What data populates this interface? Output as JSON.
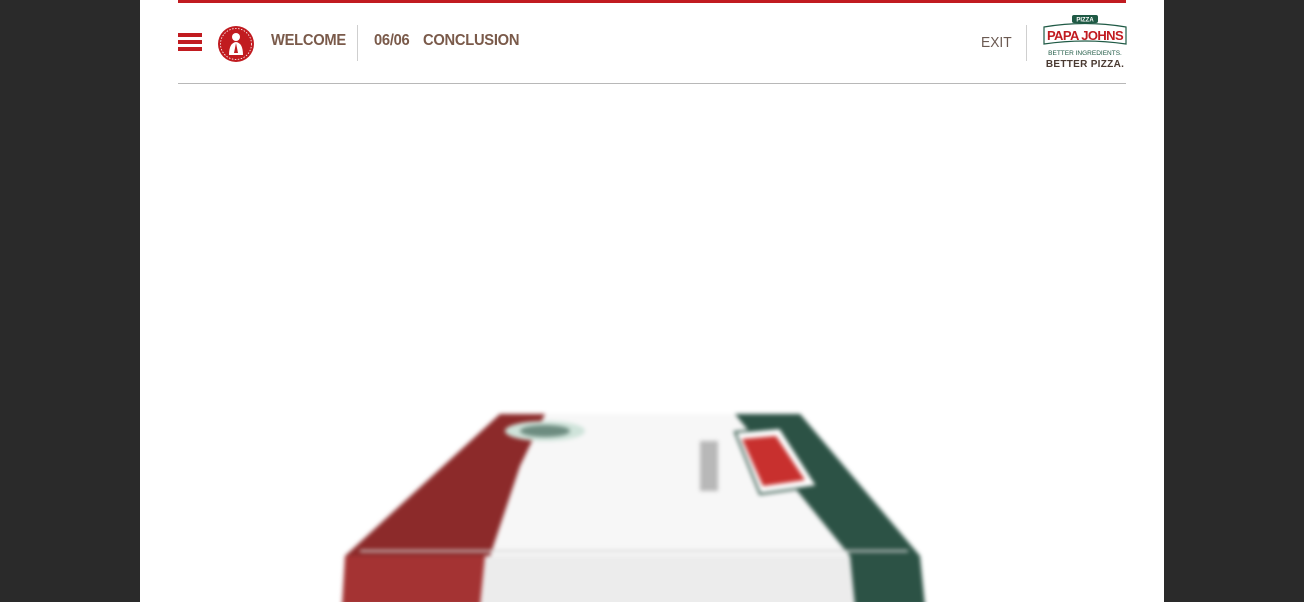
{
  "header": {
    "welcome_label": "WELCOME",
    "chapter_number": "06/06",
    "chapter_title": "CONCLUSION",
    "exit_label": "EXIT"
  },
  "logo": {
    "top_tag": "PIZZA",
    "brand": "PAPA JOHNS",
    "tagline_line1": "BETTER INGREDIENTS.",
    "tagline_line2": "BETTER PIZZA."
  },
  "colors": {
    "brand_red": "#c11b20",
    "brand_green": "#1f5a45",
    "nav_text": "#7a5a4a",
    "frame": "#2a2a2a"
  },
  "icons": {
    "menu": "hamburger-icon",
    "avatar": "papa-john-badge-icon"
  }
}
